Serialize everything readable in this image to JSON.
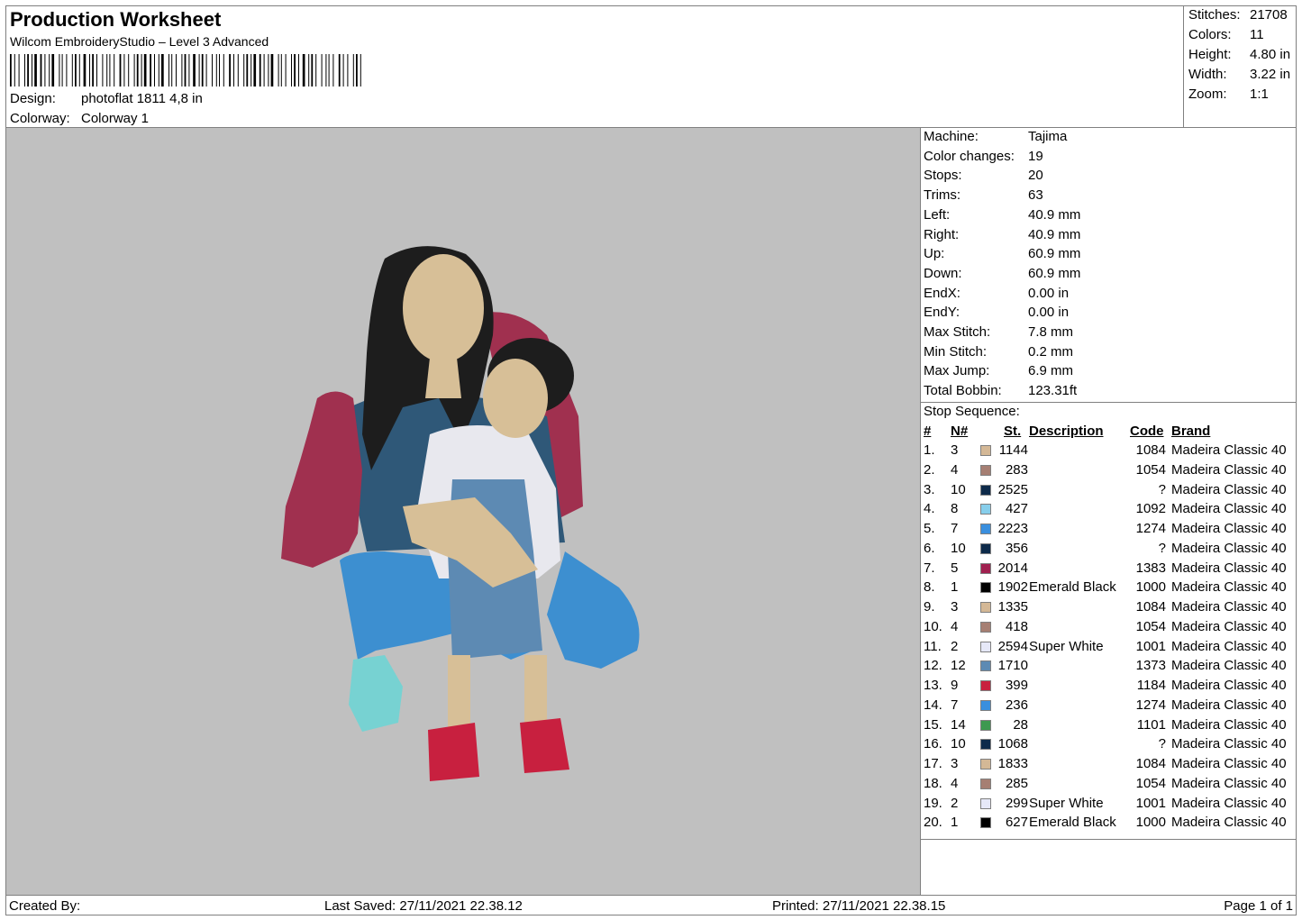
{
  "header": {
    "title": "Production Worksheet",
    "software": "Wilcom EmbroideryStudio – Level 3 Advanced",
    "design_label": "Design:",
    "design_value": "photoflat 1811 4,8 in",
    "colorway_label": "Colorway:",
    "colorway_value": "Colorway 1"
  },
  "stats": [
    {
      "label": "Stitches:",
      "value": "21708"
    },
    {
      "label": "Colors:",
      "value": "11"
    },
    {
      "label": "Height:",
      "value": "4.80 in"
    },
    {
      "label": "Width:",
      "value": "3.22 in"
    },
    {
      "label": "Zoom:",
      "value": "1:1"
    }
  ],
  "machine": [
    {
      "label": "Machine:",
      "value": "Tajima"
    },
    {
      "label": "Color changes:",
      "value": "19"
    },
    {
      "label": "Stops:",
      "value": "20"
    },
    {
      "label": "Trims:",
      "value": "63"
    },
    {
      "label": "Left:",
      "value": "40.9 mm"
    },
    {
      "label": "Right:",
      "value": "40.9 mm"
    },
    {
      "label": "Up:",
      "value": "60.9 mm"
    },
    {
      "label": "Down:",
      "value": "60.9 mm"
    },
    {
      "label": "EndX:",
      "value": "0.00 in"
    },
    {
      "label": "EndY:",
      "value": "0.00 in"
    },
    {
      "label": "Max Stitch:",
      "value": "7.8 mm"
    },
    {
      "label": "Min Stitch:",
      "value": "0.2 mm"
    },
    {
      "label": "Max Jump:",
      "value": "6.9 mm"
    },
    {
      "label": "Total Bobbin:",
      "value": "123.31ft"
    }
  ],
  "sequence": {
    "title": "Stop Sequence:",
    "headers": {
      "idx": "#",
      "n": "N#",
      "st": "St.",
      "desc": "Description",
      "code": "Code",
      "brand": "Brand"
    },
    "rows": [
      {
        "idx": "1.",
        "n": "3",
        "color": "#d4b896",
        "st": "1144",
        "desc": "",
        "code": "1084",
        "brand": "Madeira Classic 40"
      },
      {
        "idx": "2.",
        "n": "4",
        "color": "#a67f73",
        "st": "283",
        "desc": "",
        "code": "1054",
        "brand": "Madeira Classic 40"
      },
      {
        "idx": "3.",
        "n": "10",
        "color": "#0d2a4a",
        "st": "2525",
        "desc": "",
        "code": "?",
        "brand": "Madeira Classic 40"
      },
      {
        "idx": "4.",
        "n": "8",
        "color": "#87ceeb",
        "st": "427",
        "desc": "",
        "code": "1092",
        "brand": "Madeira Classic 40"
      },
      {
        "idx": "5.",
        "n": "7",
        "color": "#3a8fde",
        "st": "2223",
        "desc": "",
        "code": "1274",
        "brand": "Madeira Classic 40"
      },
      {
        "idx": "6.",
        "n": "10",
        "color": "#0d2a4a",
        "st": "356",
        "desc": "",
        "code": "?",
        "brand": "Madeira Classic 40"
      },
      {
        "idx": "7.",
        "n": "5",
        "color": "#a0204f",
        "st": "2014",
        "desc": "",
        "code": "1383",
        "brand": "Madeira Classic 40"
      },
      {
        "idx": "8.",
        "n": "1",
        "color": "#000000",
        "st": "1902",
        "desc": "Emerald Black",
        "code": "1000",
        "brand": "Madeira Classic 40"
      },
      {
        "idx": "9.",
        "n": "3",
        "color": "#d4b896",
        "st": "1335",
        "desc": "",
        "code": "1084",
        "brand": "Madeira Classic 40"
      },
      {
        "idx": "10.",
        "n": "4",
        "color": "#a67f73",
        "st": "418",
        "desc": "",
        "code": "1054",
        "brand": "Madeira Classic 40"
      },
      {
        "idx": "11.",
        "n": "2",
        "color": "#e6e8f8",
        "st": "2594",
        "desc": "Super White",
        "code": "1001",
        "brand": "Madeira Classic 40"
      },
      {
        "idx": "12.",
        "n": "12",
        "color": "#5d8ab3",
        "st": "1710",
        "desc": "",
        "code": "1373",
        "brand": "Madeira Classic 40"
      },
      {
        "idx": "13.",
        "n": "9",
        "color": "#c8203f",
        "st": "399",
        "desc": "",
        "code": "1184",
        "brand": "Madeira Classic 40"
      },
      {
        "idx": "14.",
        "n": "7",
        "color": "#3a8fde",
        "st": "236",
        "desc": "",
        "code": "1274",
        "brand": "Madeira Classic 40"
      },
      {
        "idx": "15.",
        "n": "14",
        "color": "#3e9950",
        "st": "28",
        "desc": "",
        "code": "1101",
        "brand": "Madeira Classic 40"
      },
      {
        "idx": "16.",
        "n": "10",
        "color": "#0d2a4a",
        "st": "1068",
        "desc": "",
        "code": "?",
        "brand": "Madeira Classic 40"
      },
      {
        "idx": "17.",
        "n": "3",
        "color": "#d4b896",
        "st": "1833",
        "desc": "",
        "code": "1084",
        "brand": "Madeira Classic 40"
      },
      {
        "idx": "18.",
        "n": "4",
        "color": "#a67f73",
        "st": "285",
        "desc": "",
        "code": "1054",
        "brand": "Madeira Classic 40"
      },
      {
        "idx": "19.",
        "n": "2",
        "color": "#e6e8f8",
        "st": "299",
        "desc": "Super White",
        "code": "1001",
        "brand": "Madeira Classic 40"
      },
      {
        "idx": "20.",
        "n": "1",
        "color": "#000000",
        "st": "627",
        "desc": "Emerald Black",
        "code": "1000",
        "brand": "Madeira Classic 40"
      }
    ]
  },
  "footer": {
    "created_by": "Created By:",
    "last_saved": "Last Saved: 27/11/2021 22.38.12",
    "printed": "Printed: 27/11/2021 22.38.15",
    "page": "Page 1 of 1"
  }
}
